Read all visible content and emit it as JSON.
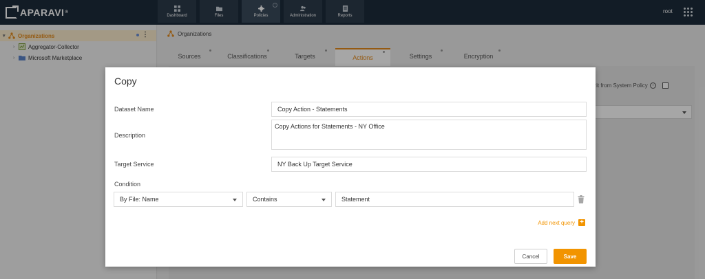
{
  "app": {
    "logo_text": "APARAVI",
    "logo_reg": "®"
  },
  "nav": {
    "items": [
      {
        "label": "Dashboard",
        "icon": "dashboard-icon"
      },
      {
        "label": "Files",
        "icon": "folder-icon"
      },
      {
        "label": "Policies",
        "icon": "gear-icon",
        "active": true
      },
      {
        "label": "Administration",
        "icon": "users-icon"
      },
      {
        "label": "Reports",
        "icon": "report-icon"
      }
    ],
    "user": "root"
  },
  "sidebar": {
    "root": {
      "label": "Organizations",
      "icon": "organization-icon"
    },
    "children": [
      {
        "label": "Aggregator-Collector",
        "icon": "aggregator-icon"
      },
      {
        "label": "Microsoft Marketplace",
        "icon": "folder-icon"
      }
    ]
  },
  "main": {
    "breadcrumb": "Organizations",
    "tabs": [
      {
        "label": "Sources"
      },
      {
        "label": "Classifications"
      },
      {
        "label": "Targets"
      },
      {
        "label": "Actions",
        "active": true
      },
      {
        "label": "Settings"
      },
      {
        "label": "Encryption"
      }
    ],
    "inherit_label": "erit from System Policy"
  },
  "modal": {
    "title": "Copy",
    "fields": {
      "dataset_name": {
        "label": "Dataset Name",
        "value": "Copy Action - Statements"
      },
      "description": {
        "label": "Description",
        "value": "Copy Actions for Statements - NY Office"
      },
      "target_service": {
        "label": "Target Service",
        "value": "NY Back Up Target Service"
      }
    },
    "condition": {
      "label": "Condition",
      "field": "By File: Name",
      "operator": "Contains",
      "value": "Statement"
    },
    "add_query_label": "Add next query",
    "cancel_label": "Cancel",
    "save_label": "Save"
  },
  "colors": {
    "accent": "#f29400",
    "topbar": "#1c2b3b"
  }
}
